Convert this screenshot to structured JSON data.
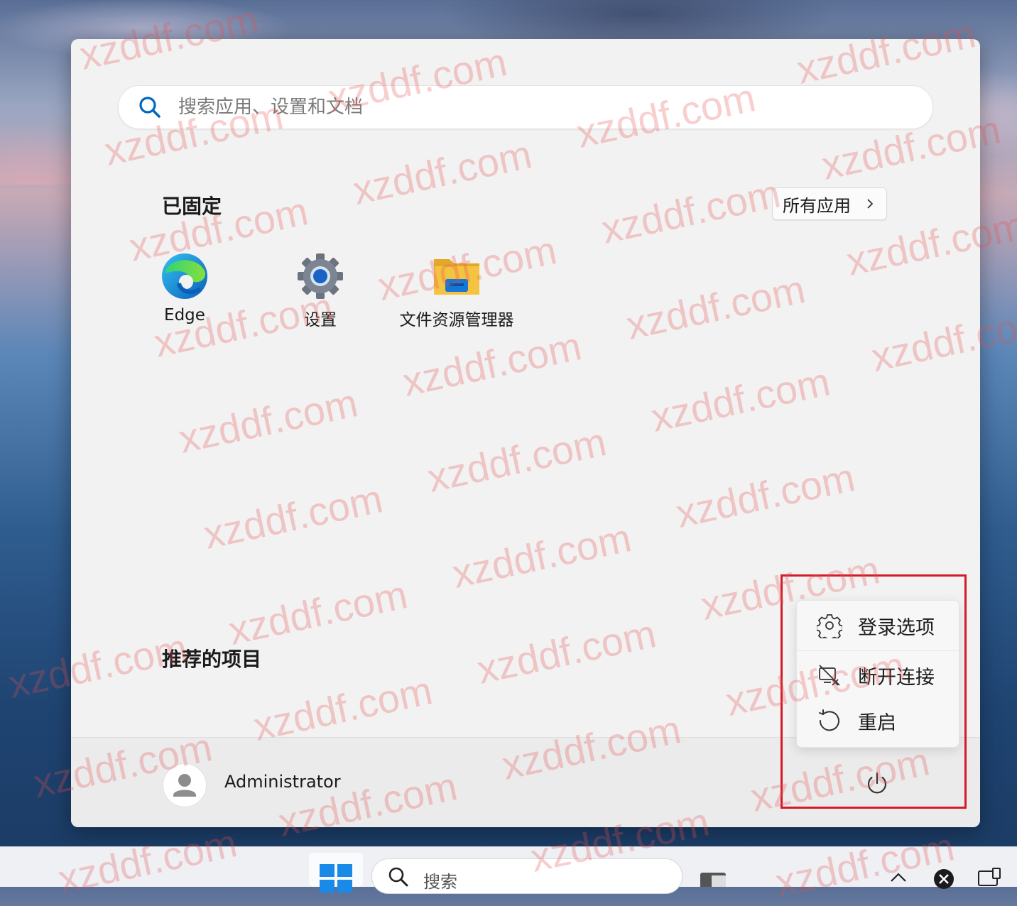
{
  "search": {
    "placeholder": "搜索应用、设置和文档"
  },
  "pinned": {
    "title": "已固定",
    "all_apps_label": "所有应用",
    "apps": [
      {
        "label": "Edge",
        "icon": "edge-icon"
      },
      {
        "label": "设置",
        "icon": "gear-icon"
      },
      {
        "label": "文件资源管理器",
        "icon": "folder-icon"
      }
    ]
  },
  "recommended": {
    "title": "推荐的项目"
  },
  "user": {
    "name": "Administrator",
    "icon": "avatar-icon"
  },
  "power_menu": {
    "items": [
      {
        "label": "登录选项",
        "icon": "gear-outline-icon"
      },
      {
        "label": "断开连接",
        "icon": "disconnect-icon"
      },
      {
        "label": "重启",
        "icon": "restart-icon"
      }
    ]
  },
  "taskbar": {
    "search_label": "搜索"
  },
  "watermark": {
    "text": "xzddf.com"
  },
  "colors": {
    "highlight": "#d41b27",
    "accent": "#0067c0",
    "folder": "#f5c342"
  }
}
